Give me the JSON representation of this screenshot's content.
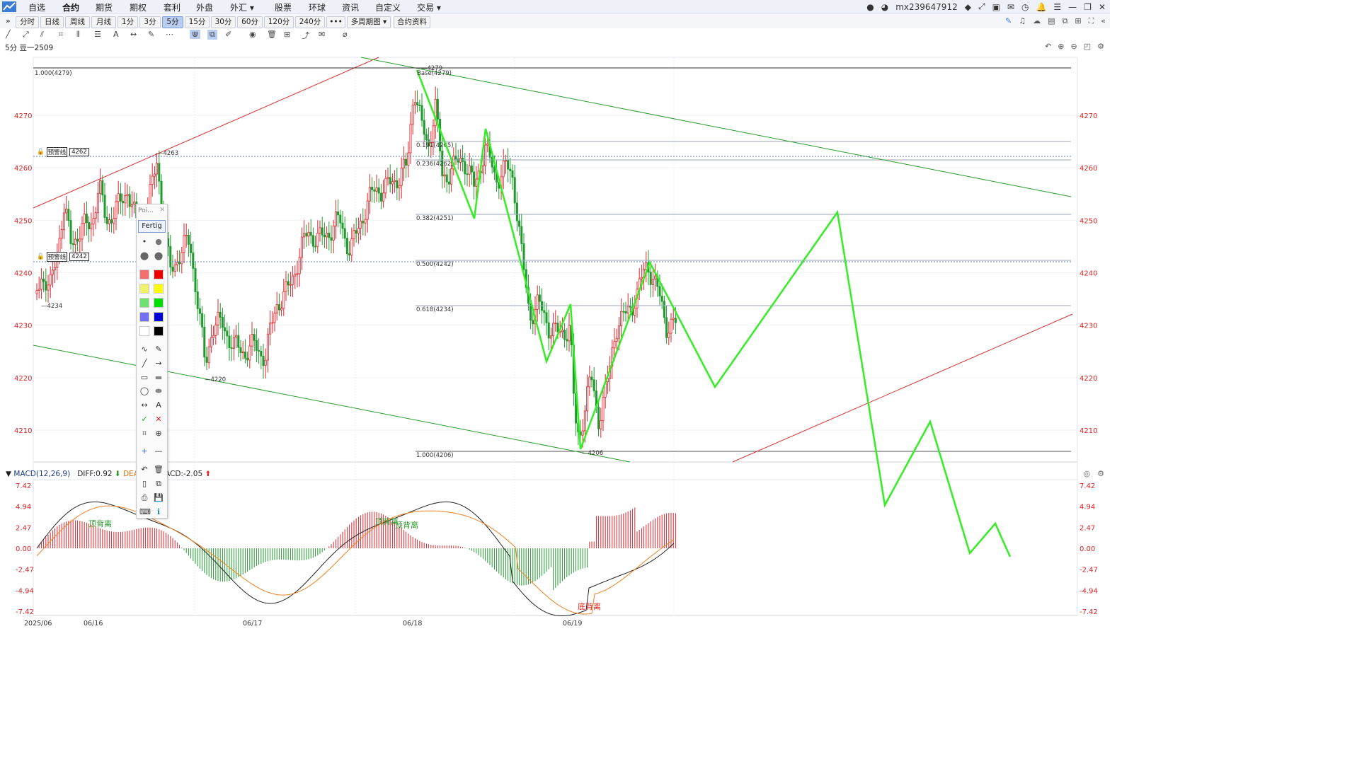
{
  "menu": {
    "items": [
      "自选",
      "合约",
      "期货",
      "期权",
      "套利",
      "外盘",
      "外汇 ▾",
      "股票",
      "环球",
      "资讯",
      "自定义",
      "交易 ▾"
    ],
    "active_index": 1,
    "user": "mx239647912"
  },
  "periods": {
    "buttons": [
      "分时",
      "日线",
      "周线",
      "月线",
      "1分",
      "3分",
      "5分",
      "15分",
      "30分",
      "60分",
      "120分",
      "240分",
      "•••",
      "多周期图 ▾",
      "合约资料"
    ],
    "active": "5分"
  },
  "symbol": "5分  豆一2509",
  "chart": {
    "y_labels": [
      "4270",
      "4260",
      "4250",
      "4240",
      "4230",
      "4220",
      "4210"
    ],
    "price_marks": {
      "high_left": "1.000(4279)",
      "p4279": "4279",
      "base": "Base(4279)",
      "p4263": "4263",
      "p4234": "4234",
      "p4220": "4220",
      "p4206": "4206",
      "alert1_label": "预警线",
      "alert1_value": "4262",
      "alert2_label": "预警线",
      "alert2_value": "4242"
    },
    "fib": [
      "0.191(4265)",
      "0.236(4262)",
      "0.382(4251)",
      "0.500(4242)",
      "0.618(4234)",
      "1.000(4206)"
    ]
  },
  "macd": {
    "title": "MACD(12,26,9)",
    "diff": "DIFF:0.92",
    "dea": "DEA:1",
    "macd_val": "ACD:-2.05",
    "y_labels": [
      "7.42",
      "4.94",
      "2.47",
      "0.00",
      "-2.47",
      "-4.94",
      "-7.42"
    ],
    "annotations": [
      "顶背离",
      "顶背离",
      "顶背离",
      "底背离"
    ]
  },
  "x_labels": [
    "2025/06",
    "06/16",
    "06/17",
    "06/18",
    "06/19"
  ],
  "palette": {
    "title": "Poi...",
    "done": "Fertig"
  },
  "colors": {
    "up": "#e2252b",
    "down": "#1f9a2c",
    "user_line": "#33ee22",
    "red_trend": "#e03030",
    "green_trend": "#2a9a2a",
    "accent": "#1a5fd3"
  }
}
